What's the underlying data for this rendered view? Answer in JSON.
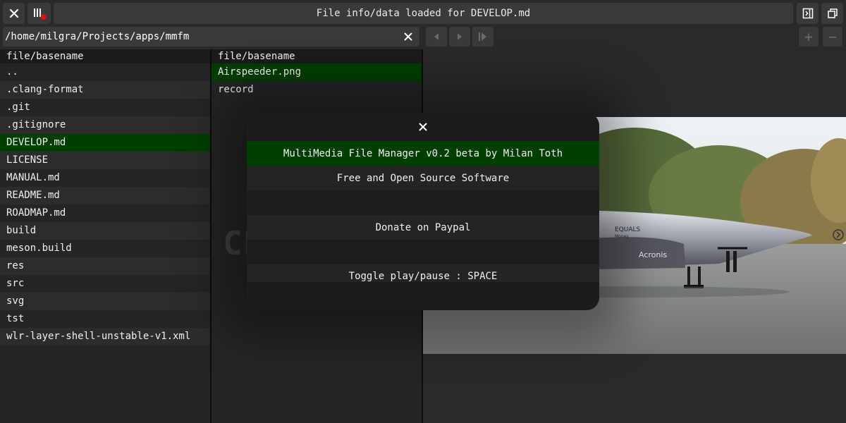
{
  "topbar": {
    "close_icon": "close-icon",
    "menu_icon": "menu-bars-icon",
    "title": "File info/data loaded for DEVELOP.md",
    "right_icons": [
      "panel-toggle-icon",
      "maximize-icon"
    ]
  },
  "pathbar": {
    "value": "/home/milgra/Projects/apps/mmfm",
    "clear_icon": "close-icon"
  },
  "nav": {
    "icons": [
      "prev-icon",
      "play-icon",
      "next-icon"
    ],
    "zoom_icons": [
      "plus-icon",
      "minus-icon"
    ],
    "plus": "+",
    "minus": "−"
  },
  "left_pane": {
    "header": "file/basename",
    "items": [
      "..",
      ".clang-format",
      ".git",
      ".gitignore",
      "DEVELOP.md",
      "LICENSE",
      "MANUAL.md",
      "README.md",
      "ROADMAP.md",
      "build",
      "meson.build",
      "res",
      "src",
      "svg",
      "tst",
      "wlr-layer-shell-unstable-v1.xml"
    ],
    "selected_index": 4
  },
  "middle_pane": {
    "header": "file/basename",
    "items": [
      "Airspeeder.png",
      "record"
    ],
    "selected_index": 0
  },
  "ghost_text": "CL",
  "image": {
    "texts": [
      "EQUALS",
      "Money",
      "Acronis"
    ]
  },
  "modal": {
    "close_icon": "close-icon",
    "lines": [
      "MultiMedia File Manager v0.2 beta by Milan Toth",
      "Free and Open Source Software",
      "",
      "Donate on Paypal",
      "",
      "Toggle play/pause : SPACE"
    ],
    "highlight_index": 0,
    "colors": {
      "highlight": "#013f00"
    }
  },
  "colors": {
    "background": "#2a2a2a",
    "selection": "#013f00",
    "button": "#3a3a3a"
  }
}
